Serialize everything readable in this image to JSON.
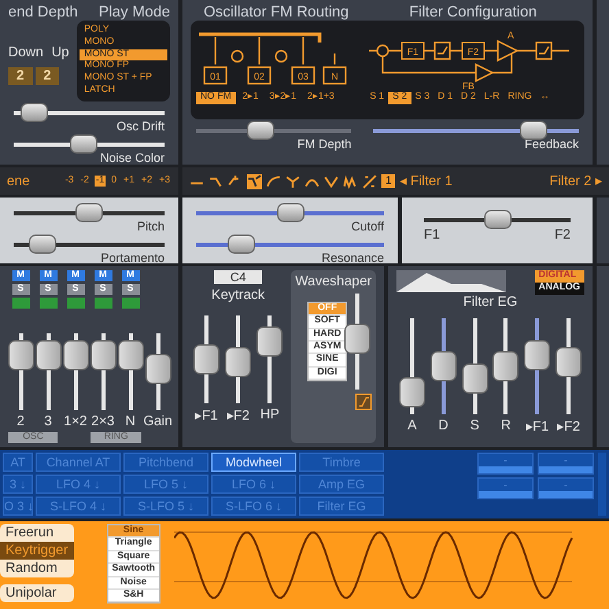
{
  "pitchbend": {
    "title": "end Depth",
    "labels": [
      "Down",
      "Up"
    ],
    "values": [
      "2",
      "2"
    ]
  },
  "play_mode": {
    "title": "Play Mode",
    "options": [
      {
        "label": "POLY",
        "selected": false
      },
      {
        "label": "MONO",
        "selected": false
      },
      {
        "label": "MONO ST",
        "selected": true
      },
      {
        "label": "MONO FP",
        "selected": false
      },
      {
        "label": "MONO ST + FP",
        "selected": false
      },
      {
        "label": "LATCH",
        "selected": false
      }
    ]
  },
  "osc_sliders": [
    {
      "label": "Osc Drift",
      "level": 0.05
    },
    {
      "label": "Noise Color",
      "level": 0.45
    }
  ],
  "fm_routing": {
    "title": "Oscillator FM Routing",
    "nodes": [
      "01",
      "02",
      "03",
      "N"
    ],
    "options": [
      {
        "label": "NO FM",
        "selected": true
      },
      {
        "label": "2▸1",
        "selected": false
      },
      {
        "label": "3▸2▸1",
        "selected": false
      },
      {
        "label": "2▸1+3",
        "selected": false
      }
    ],
    "slider": {
      "label": "FM Depth",
      "level": 0.4
    }
  },
  "filter_config": {
    "title": "Filter Configuration",
    "blocks": [
      "F1",
      "F2"
    ],
    "amp": "A",
    "feedback": "FB",
    "options": [
      {
        "label": "S 1",
        "selected": false
      },
      {
        "label": "S 2",
        "selected": true
      },
      {
        "label": "S 3",
        "selected": false
      },
      {
        "label": "D 1",
        "selected": false
      },
      {
        "label": "D 2",
        "selected": false
      },
      {
        "label": "L-R",
        "selected": false
      },
      {
        "label": "RING",
        "selected": false
      },
      {
        "label": "↔",
        "selected": false
      }
    ],
    "slider": {
      "label": "Feedback",
      "level": 0.82
    }
  },
  "scene_bar": {
    "label": "ene",
    "options": [
      {
        "label": "-3",
        "selected": false
      },
      {
        "label": "-2",
        "selected": false
      },
      {
        "label": "-1",
        "selected": true
      },
      {
        "label": "0",
        "selected": false
      },
      {
        "label": "+1",
        "selected": false
      },
      {
        "label": "+2",
        "selected": false
      },
      {
        "label": "+3",
        "selected": false
      }
    ]
  },
  "filter_bar": {
    "types": [
      {
        "selected": false
      },
      {
        "selected": false
      },
      {
        "selected": false
      },
      {
        "selected": true
      },
      {
        "selected": false
      },
      {
        "selected": false
      },
      {
        "selected": false
      },
      {
        "selected": false
      },
      {
        "selected": false
      },
      {
        "selected": false
      }
    ],
    "badge": "1",
    "left": "◂ Filter 1",
    "right": "Filter 2 ▸"
  },
  "pitch_sliders": [
    {
      "label": "Pitch",
      "level": 0.5
    },
    {
      "label": "Portamento",
      "level": 0.12
    }
  ],
  "filter_sliders": [
    {
      "label": "Cutoff",
      "level": 0.5
    },
    {
      "label": "Resonance",
      "level": 0.2
    }
  ],
  "balance": {
    "left": "F1",
    "right": "F2",
    "level": 0.5
  },
  "mixer": {
    "channels": [
      {
        "label": "2",
        "mute": "M",
        "solo": "S",
        "level": 0.85
      },
      {
        "label": "3",
        "mute": "M",
        "solo": "S",
        "level": 0.85
      },
      {
        "label": "1×2",
        "mute": "M",
        "solo": "S",
        "level": 0.85
      },
      {
        "label": "2×3",
        "mute": "M",
        "solo": "S",
        "level": 0.85
      },
      {
        "label": "N",
        "mute": "M",
        "solo": "S",
        "level": 0.85
      },
      {
        "label": "Gain",
        "level": 0.55
      }
    ],
    "groups": [
      "OSC",
      "RING"
    ]
  },
  "keytrack": {
    "note": "C4",
    "title": "Keytrack",
    "faders": [
      {
        "label": "▸F1",
        "level": 0.5
      },
      {
        "label": "▸F2",
        "level": 0.45
      },
      {
        "label": "HP",
        "level": 0.8
      }
    ]
  },
  "waveshaper": {
    "title": "Waveshaper",
    "options": [
      {
        "label": "OFF",
        "selected": true
      },
      {
        "label": "SOFT",
        "selected": false
      },
      {
        "label": "HARD",
        "selected": false
      },
      {
        "label": "ASYM",
        "selected": false
      },
      {
        "label": "SINE",
        "selected": false
      },
      {
        "label": "DIGI",
        "selected": false
      }
    ],
    "level": 0.55
  },
  "filter_eg": {
    "title": "Filter EG",
    "modes": [
      {
        "label": "DIGITAL",
        "selected": true
      },
      {
        "label": "ANALOG",
        "selected": false
      }
    ],
    "faders": [
      {
        "label": "A",
        "level": 0.1
      },
      {
        "label": "D",
        "level": 0.5
      },
      {
        "label": "S",
        "level": 0.3
      },
      {
        "label": "R",
        "level": 0.5
      },
      {
        "label": "▸F1",
        "level": 0.65
      },
      {
        "label": "▸F2",
        "level": 0.55
      }
    ]
  },
  "mod_sources": [
    [
      {
        "label": "AT",
        "selected": false
      },
      {
        "label": "Channel AT",
        "selected": false
      },
      {
        "label": "Pitchbend",
        "selected": false
      },
      {
        "label": "Modwheel",
        "selected": true
      },
      {
        "label": "Timbre",
        "selected": false
      }
    ],
    [
      {
        "label": "3 ↓",
        "selected": false
      },
      {
        "label": "LFO 4 ↓",
        "selected": false
      },
      {
        "label": "LFO 5 ↓",
        "selected": false
      },
      {
        "label": "LFO 6 ↓",
        "selected": false
      },
      {
        "label": "Amp EG",
        "selected": false
      }
    ],
    [
      {
        "label": "O 3 ↓",
        "selected": false
      },
      {
        "label": "S-LFO 4 ↓",
        "selected": false
      },
      {
        "label": "S-LFO 5 ↓",
        "selected": false
      },
      {
        "label": "S-LFO 6 ↓",
        "selected": false
      },
      {
        "label": "Filter EG",
        "selected": false
      }
    ]
  ],
  "mod_slots": [
    [
      "-",
      "-"
    ],
    [
      "-",
      "-"
    ]
  ],
  "lfo": {
    "triggers": [
      {
        "label": "Freerun",
        "selected": false
      },
      {
        "label": "Keytrigger",
        "selected": true
      },
      {
        "label": "Random",
        "selected": false
      }
    ],
    "polarity": "Unipolar",
    "shapes": [
      {
        "label": "Sine",
        "selected": true
      },
      {
        "label": "Triangle",
        "selected": false
      },
      {
        "label": "Square",
        "selected": false
      },
      {
        "label": "Sawtooth",
        "selected": false
      },
      {
        "label": "Noise",
        "selected": false
      },
      {
        "label": "S&H",
        "selected": false
      }
    ]
  }
}
